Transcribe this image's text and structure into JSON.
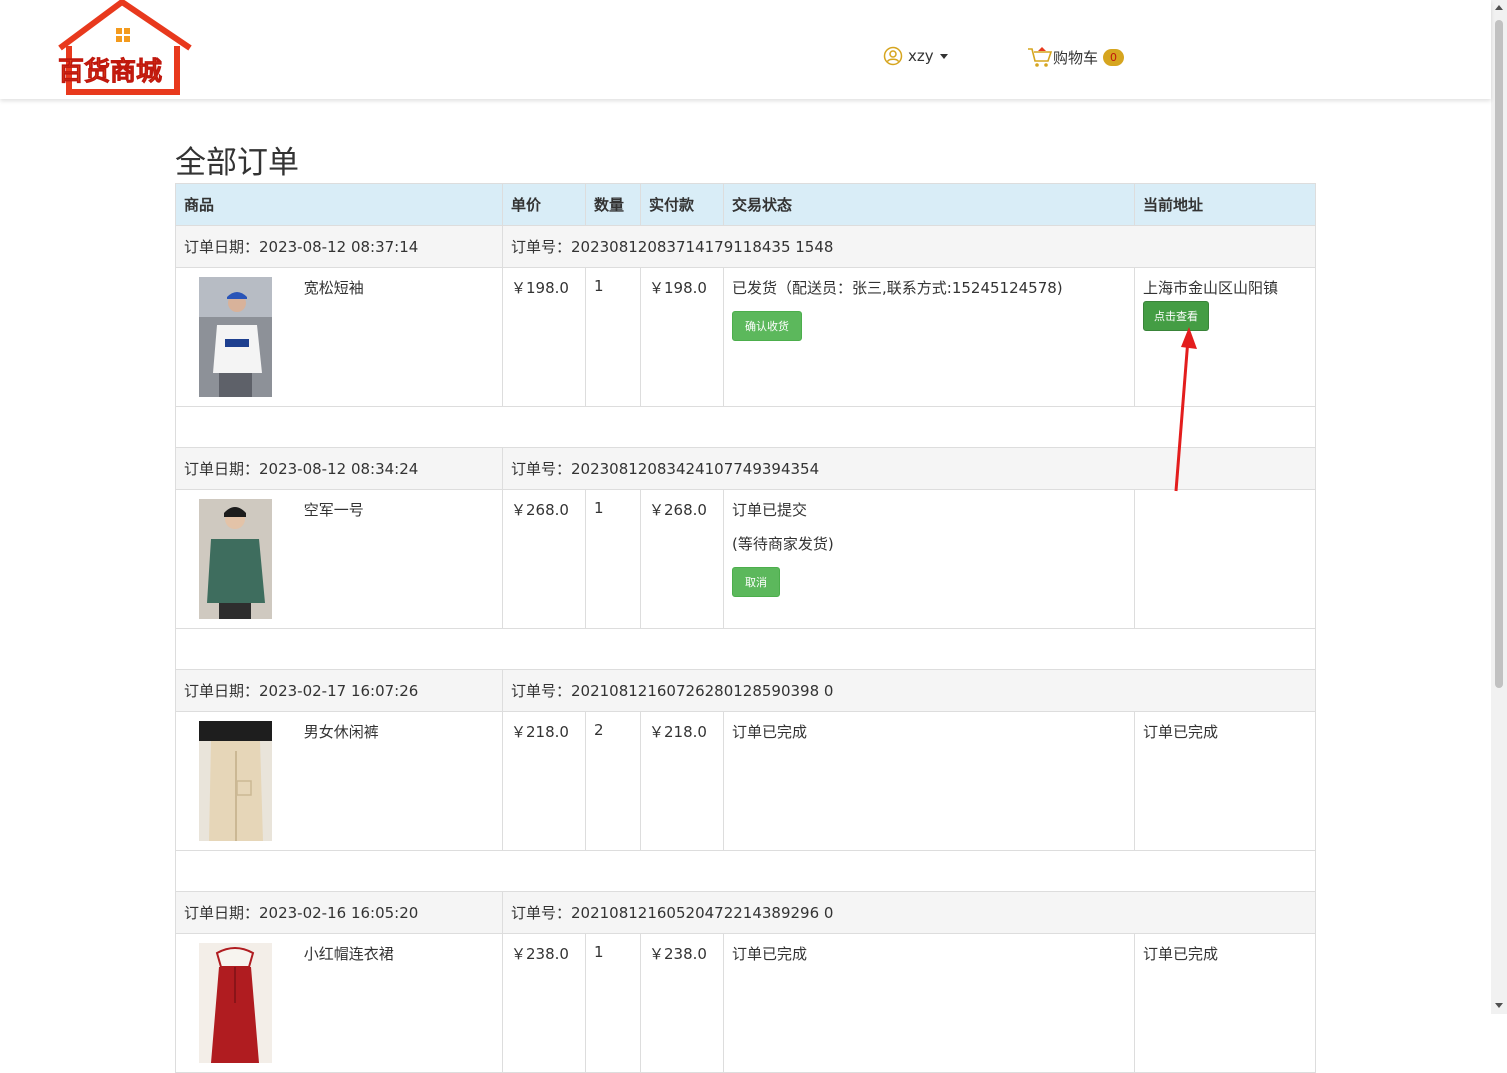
{
  "header": {
    "logo_text": "百货商城",
    "username": "xzy",
    "cart_label": "购物车",
    "cart_count": "0"
  },
  "page_title": "全部订单",
  "columns": [
    "商品",
    "单价",
    "数量",
    "实付款",
    "交易状态",
    "当前地址"
  ],
  "orders": [
    {
      "date": "订单日期：2023-08-12 08:37:14",
      "number": "订单号：20230812083714179118435 1548",
      "product": "宽松短袖",
      "price": "￥198.0",
      "qty": "1",
      "paid": "￥198.0",
      "status": "已发货（配送员：张三,联系方式:15245124578)",
      "status_sub": "",
      "button": "确认收货",
      "address": "上海市金山区山阳镇",
      "address_button": "点击查看"
    },
    {
      "date": "订单日期：2023-08-12 08:34:24",
      "number": "订单号：20230812083424107749394354",
      "product": "空军一号",
      "price": "￥268.0",
      "qty": "1",
      "paid": "￥268.0",
      "status": "订单已提交",
      "status_sub": "(等待商家发货)",
      "button": "取消",
      "address": "",
      "address_button": ""
    },
    {
      "date": "订单日期：2023-02-17 16:07:26",
      "number": "订单号：20210812160726280128590398 0",
      "product": "男女休闲裤",
      "price": "￥218.0",
      "qty": "2",
      "paid": "￥218.0",
      "status": "订单已完成",
      "status_sub": "",
      "button": "",
      "address": "订单已完成",
      "address_button": ""
    },
    {
      "date": "订单日期：2023-02-16 16:05:20",
      "number": "订单号：20210812160520472214389296 0",
      "product": "小红帽连衣裙",
      "price": "￥238.0",
      "qty": "1",
      "paid": "￥238.0",
      "status": "订单已完成",
      "status_sub": "",
      "button": "",
      "address": "订单已完成",
      "address_button": ""
    }
  ]
}
